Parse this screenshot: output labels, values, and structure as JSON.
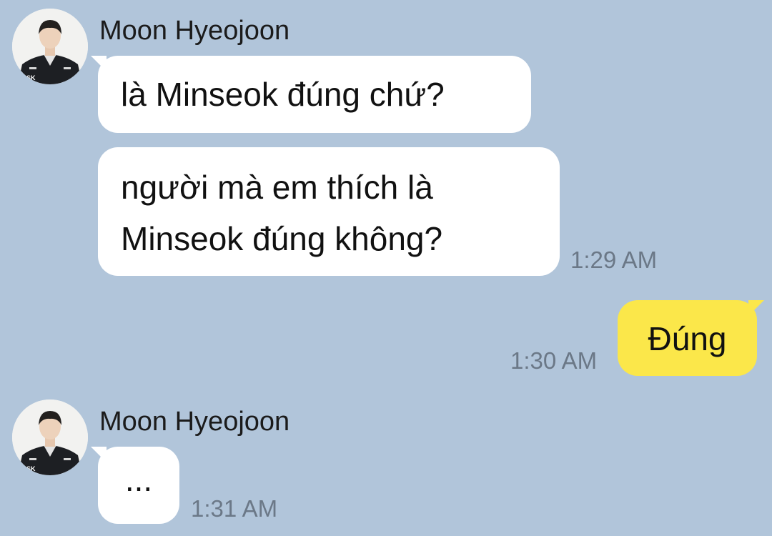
{
  "chat": {
    "background_color": "#b1c5da",
    "outgoing_bubble_color": "#fbe74a",
    "incoming_bubble_color": "#ffffff",
    "groups": [
      {
        "sender": "Moon Hyeojoon",
        "avatar_icon": "profile-avatar",
        "messages": [
          {
            "lines": [
              "là Minseok đúng chứ?"
            ]
          },
          {
            "lines": [
              "người mà em thích là",
              "Minseok đúng không?"
            ],
            "time": "1:29 AM"
          }
        ]
      },
      {
        "sender": "me",
        "messages": [
          {
            "lines": [
              "Đúng"
            ],
            "time": "1:30 AM"
          }
        ]
      },
      {
        "sender": "Moon Hyeojoon",
        "avatar_icon": "profile-avatar",
        "messages": [
          {
            "lines": [
              "..."
            ],
            "time": "1:31 AM"
          }
        ]
      }
    ]
  }
}
